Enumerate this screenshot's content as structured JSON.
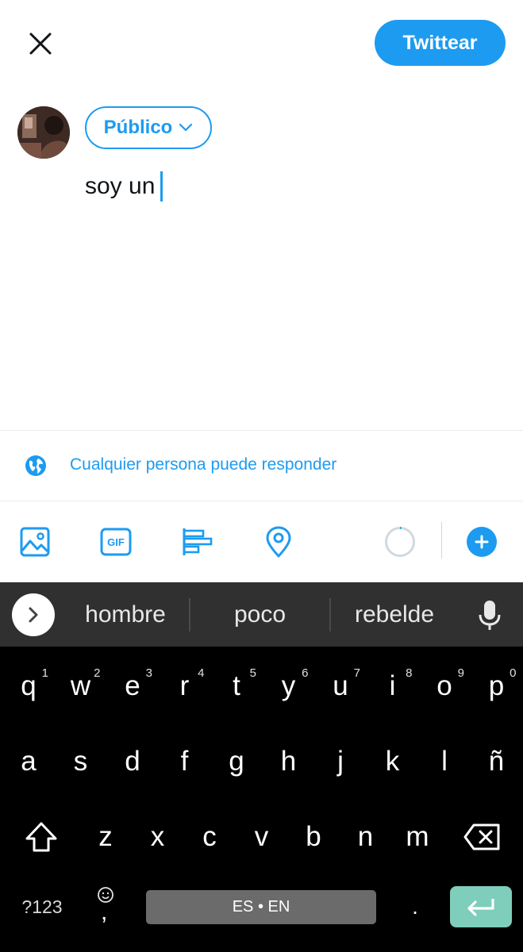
{
  "header": {
    "tweet_button": "Twittear"
  },
  "composer": {
    "audience": "Público",
    "text": "soy un"
  },
  "reply_settings": {
    "label": "Cualquier persona puede responder"
  },
  "toolbar": {
    "icons": [
      "image-icon",
      "gif-icon",
      "poll-icon",
      "location-icon"
    ],
    "gif_label": "GIF"
  },
  "keyboard": {
    "suggestions": [
      "hombre",
      "poco",
      "rebelde"
    ],
    "row1": [
      {
        "k": "q",
        "n": "1"
      },
      {
        "k": "w",
        "n": "2"
      },
      {
        "k": "e",
        "n": "3"
      },
      {
        "k": "r",
        "n": "4"
      },
      {
        "k": "t",
        "n": "5"
      },
      {
        "k": "y",
        "n": "6"
      },
      {
        "k": "u",
        "n": "7"
      },
      {
        "k": "i",
        "n": "8"
      },
      {
        "k": "o",
        "n": "9"
      },
      {
        "k": "p",
        "n": "0"
      }
    ],
    "row2": [
      "a",
      "s",
      "d",
      "f",
      "g",
      "h",
      "j",
      "k",
      "l",
      "ñ"
    ],
    "row3": [
      "z",
      "x",
      "c",
      "v",
      "b",
      "n",
      "m"
    ],
    "symbols_key": "?123",
    "comma_key": ",",
    "space_label": "ES • EN",
    "period_key": ".",
    "accent_color": "#1d9bf0"
  }
}
